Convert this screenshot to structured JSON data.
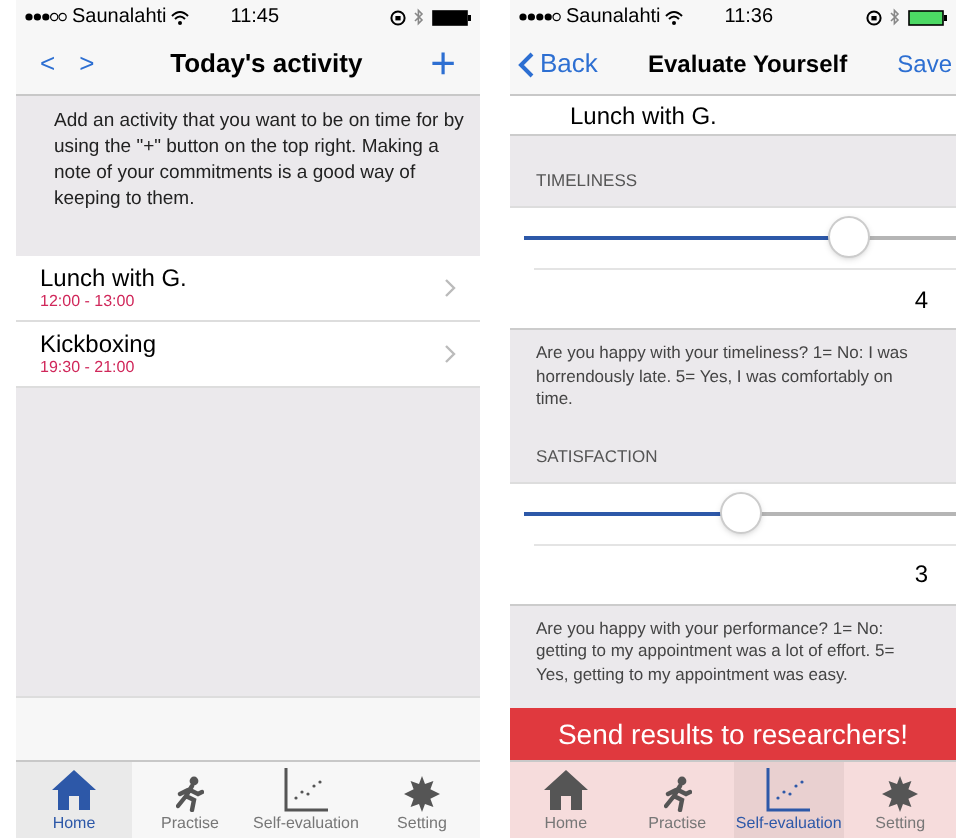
{
  "screens": [
    {
      "kind": "activity_list",
      "status_bar": {
        "carrier": "Saunalahti",
        "time": "11:45"
      },
      "nav": {
        "left": [
          "<",
          ">"
        ],
        "title": "Today's activity",
        "right": "+"
      },
      "info": "Add an activity that you want to be on time for by using the \"+\" button on the top right. Making a note of your commitments is a good way of keeping to them.",
      "activities": [
        {
          "title": "Lunch with G.",
          "time": "12:00 - 13:00"
        },
        {
          "title": "Kickboxing",
          "time": "19:30 - 21:00"
        }
      ],
      "tab_bar": [
        {
          "label": "Home",
          "selected": true
        },
        {
          "label": "Practise",
          "selected": false
        },
        {
          "label": "Self-evaluation",
          "selected": false
        },
        {
          "label": "Setting",
          "selected": false
        }
      ]
    },
    {
      "kind": "evaluation",
      "status_bar": {
        "carrier": "Saunalahti",
        "time": "11:36"
      },
      "nav": {
        "back": "Back",
        "title": "Evaluate Yourself",
        "right": "Save"
      },
      "activity": "Lunch with G.",
      "questions": [
        {
          "heading": "TIMELINESS",
          "level": 0.75,
          "value": "4",
          "note": "Are you happy with your timeliness? 1= No: I was horrendously late. 5= Yes, I was comfortably on time."
        },
        {
          "heading": "SATISFACTION",
          "level": 0.5,
          "value": "3",
          "note": "Are you happy with your performance? 1= No: getting to my appointment was a lot of effort. 5= Yes, getting to my appointment was easy."
        }
      ],
      "send_button": "Send results to researchers!",
      "tab_bar": [
        {
          "label": "Home",
          "selected": false
        },
        {
          "label": "Practise",
          "selected": false
        },
        {
          "label": "Self-evaluation",
          "selected": true
        },
        {
          "label": "Setting",
          "selected": false
        }
      ]
    }
  ]
}
